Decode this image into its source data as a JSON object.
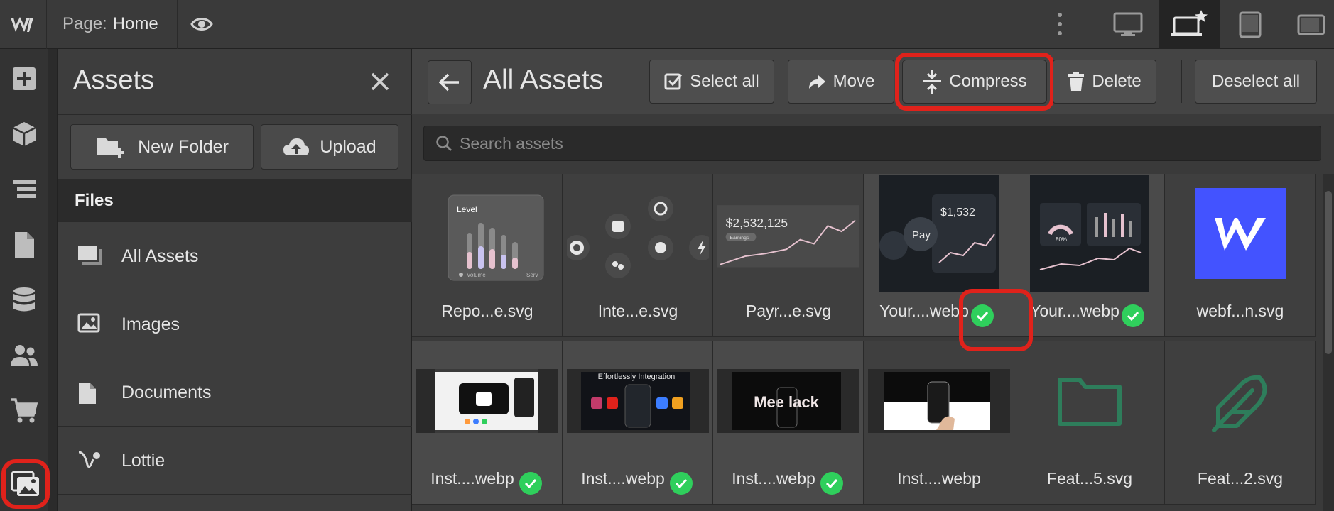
{
  "topbar": {
    "page_prefix": "Page:",
    "page_name": "Home",
    "devices": [
      "desktop-icon",
      "laptop-star-icon",
      "tablet-icon",
      "tablet-landscape-icon"
    ]
  },
  "rail": {
    "items": [
      "add-icon",
      "cube-icon",
      "navigator-icon",
      "page-icon",
      "database-icon",
      "users-icon",
      "cart-icon",
      "assets-icon"
    ]
  },
  "panel": {
    "title": "Assets",
    "new_folder": "New Folder",
    "upload": "Upload",
    "files_header": "Files",
    "files": [
      {
        "label": "All Assets",
        "icon": "all-assets-icon"
      },
      {
        "label": "Images",
        "icon": "image-icon"
      },
      {
        "label": "Documents",
        "icon": "document-icon"
      },
      {
        "label": "Lottie",
        "icon": "lottie-icon"
      }
    ]
  },
  "main": {
    "title": "All Assets",
    "select_all": "Select all",
    "move": "Move",
    "compress": "Compress",
    "delete": "Delete",
    "deselect_all": "Deselect all",
    "search_placeholder": "Search assets"
  },
  "assets": [
    {
      "name": "Repo...e.svg",
      "selected": false
    },
    {
      "name": "Inte...e.svg",
      "selected": false
    },
    {
      "name": "Payr...e.svg",
      "selected": false,
      "amount": "$2,532,125",
      "sub": "Earnings"
    },
    {
      "name": "Your....webp",
      "selected": true,
      "amount": "$1,532",
      "pay": "Pay"
    },
    {
      "name": "Your....webp",
      "selected": true
    },
    {
      "name": "webf...n.svg",
      "selected": false
    },
    {
      "name": "Inst....webp",
      "selected": true
    },
    {
      "name": "Inst....webp",
      "selected": true,
      "caption": "Effortlessly Integration"
    },
    {
      "name": "Inst....webp",
      "selected": true,
      "caption": "Mee  lack"
    },
    {
      "name": "Inst....webp",
      "selected": false
    },
    {
      "name": "Feat...5.svg",
      "selected": false
    },
    {
      "name": "Feat...2.svg",
      "selected": false
    }
  ],
  "thumb_text": {
    "level": "Level",
    "volume": "Volume",
    "serv": "Serv",
    "percent": "80%"
  },
  "colors": {
    "highlight": "#e0221b",
    "check": "#2fcf5c",
    "webflow_blue": "#4353ff",
    "feature_green": "#2e7d5b"
  }
}
